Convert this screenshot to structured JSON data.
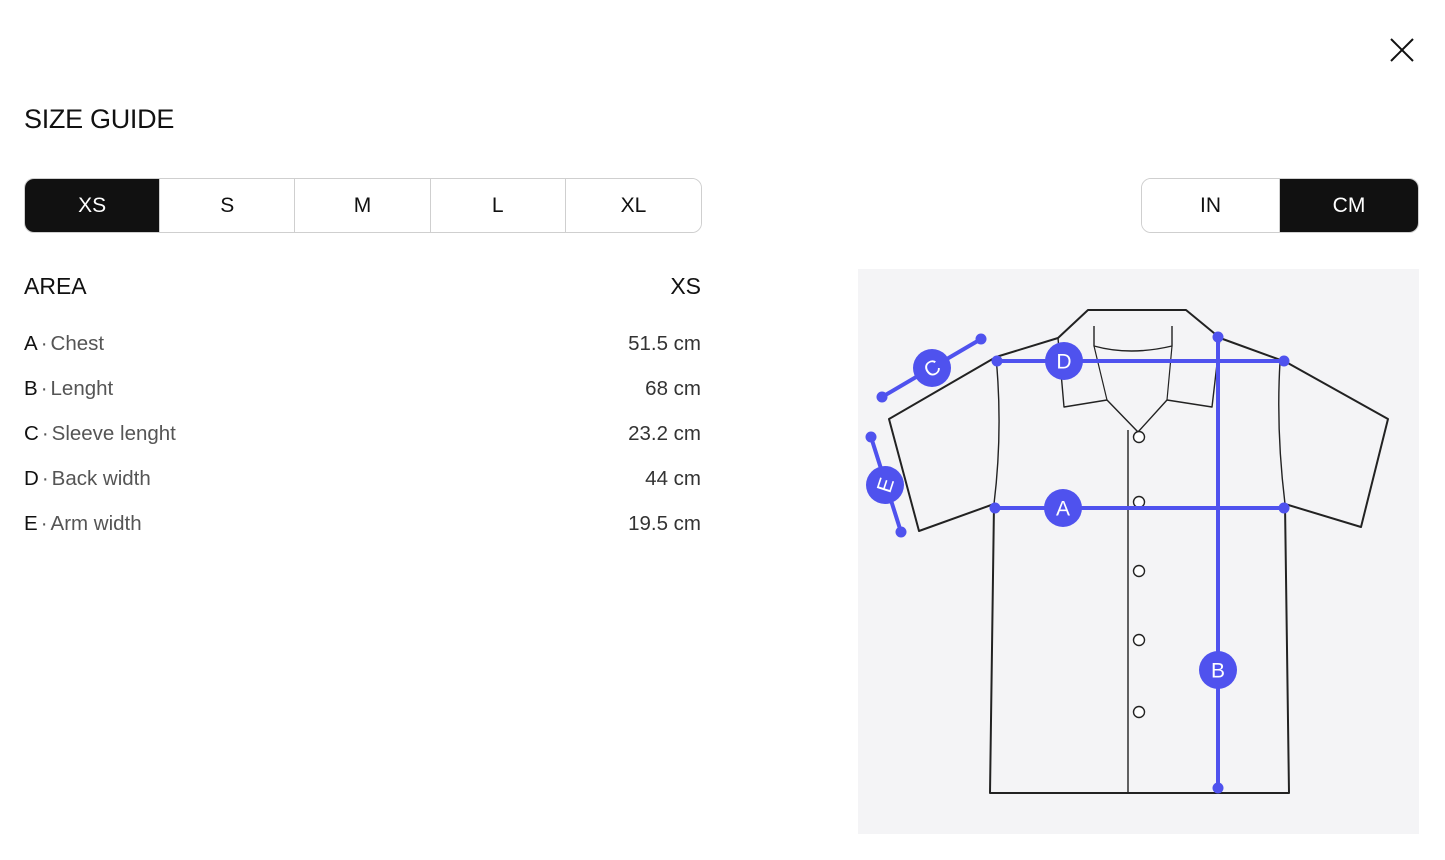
{
  "modal": {
    "title": "SIZE GUIDE",
    "close_icon": "close-icon"
  },
  "sizes": {
    "selected": "XS",
    "options": [
      "XS",
      "S",
      "M",
      "L",
      "XL"
    ]
  },
  "units": {
    "selected": "CM",
    "options": [
      "IN",
      "CM"
    ]
  },
  "table": {
    "area_header": "AREA",
    "size_header": "XS",
    "rows": [
      {
        "letter": "A",
        "name": "Chest",
        "value": "51.5 cm"
      },
      {
        "letter": "B",
        "name": "Lenght",
        "value": "68 cm"
      },
      {
        "letter": "C",
        "name": "Sleeve lenght",
        "value": "23.2 cm"
      },
      {
        "letter": "D",
        "name": "Back width",
        "value": "44 cm"
      },
      {
        "letter": "E",
        "name": "Arm width",
        "value": "19.5 cm"
      }
    ]
  },
  "diagram": {
    "marker_labels": [
      "A",
      "B",
      "C",
      "D",
      "E"
    ],
    "accent_color": "#4f52ee",
    "outline_color": "#222222"
  }
}
